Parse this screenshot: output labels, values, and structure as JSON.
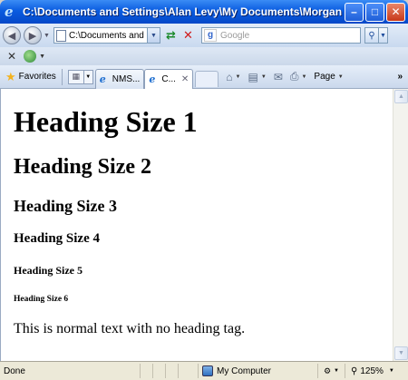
{
  "window": {
    "title": "C:\\Documents and Settings\\Alan Levy\\My Documents\\Morgan School\\HTML..."
  },
  "address": {
    "url": "C:\\Documents and Set"
  },
  "search": {
    "placeholder": "Google"
  },
  "toolbar": {
    "favorites_label": "Favorites",
    "page_label": "Page"
  },
  "tabs": [
    {
      "label": "NMS..."
    },
    {
      "label": "C..."
    }
  ],
  "content": {
    "h1": "Heading Size 1",
    "h2": "Heading Size 2",
    "h3": "Heading Size 3",
    "h4": "Heading Size 4",
    "h5": "Heading Size 5",
    "h6": "Heading Size 6",
    "paragraph": "This is normal text with no heading tag."
  },
  "status": {
    "text": "Done",
    "zone": "My Computer",
    "zoom": "125%"
  }
}
